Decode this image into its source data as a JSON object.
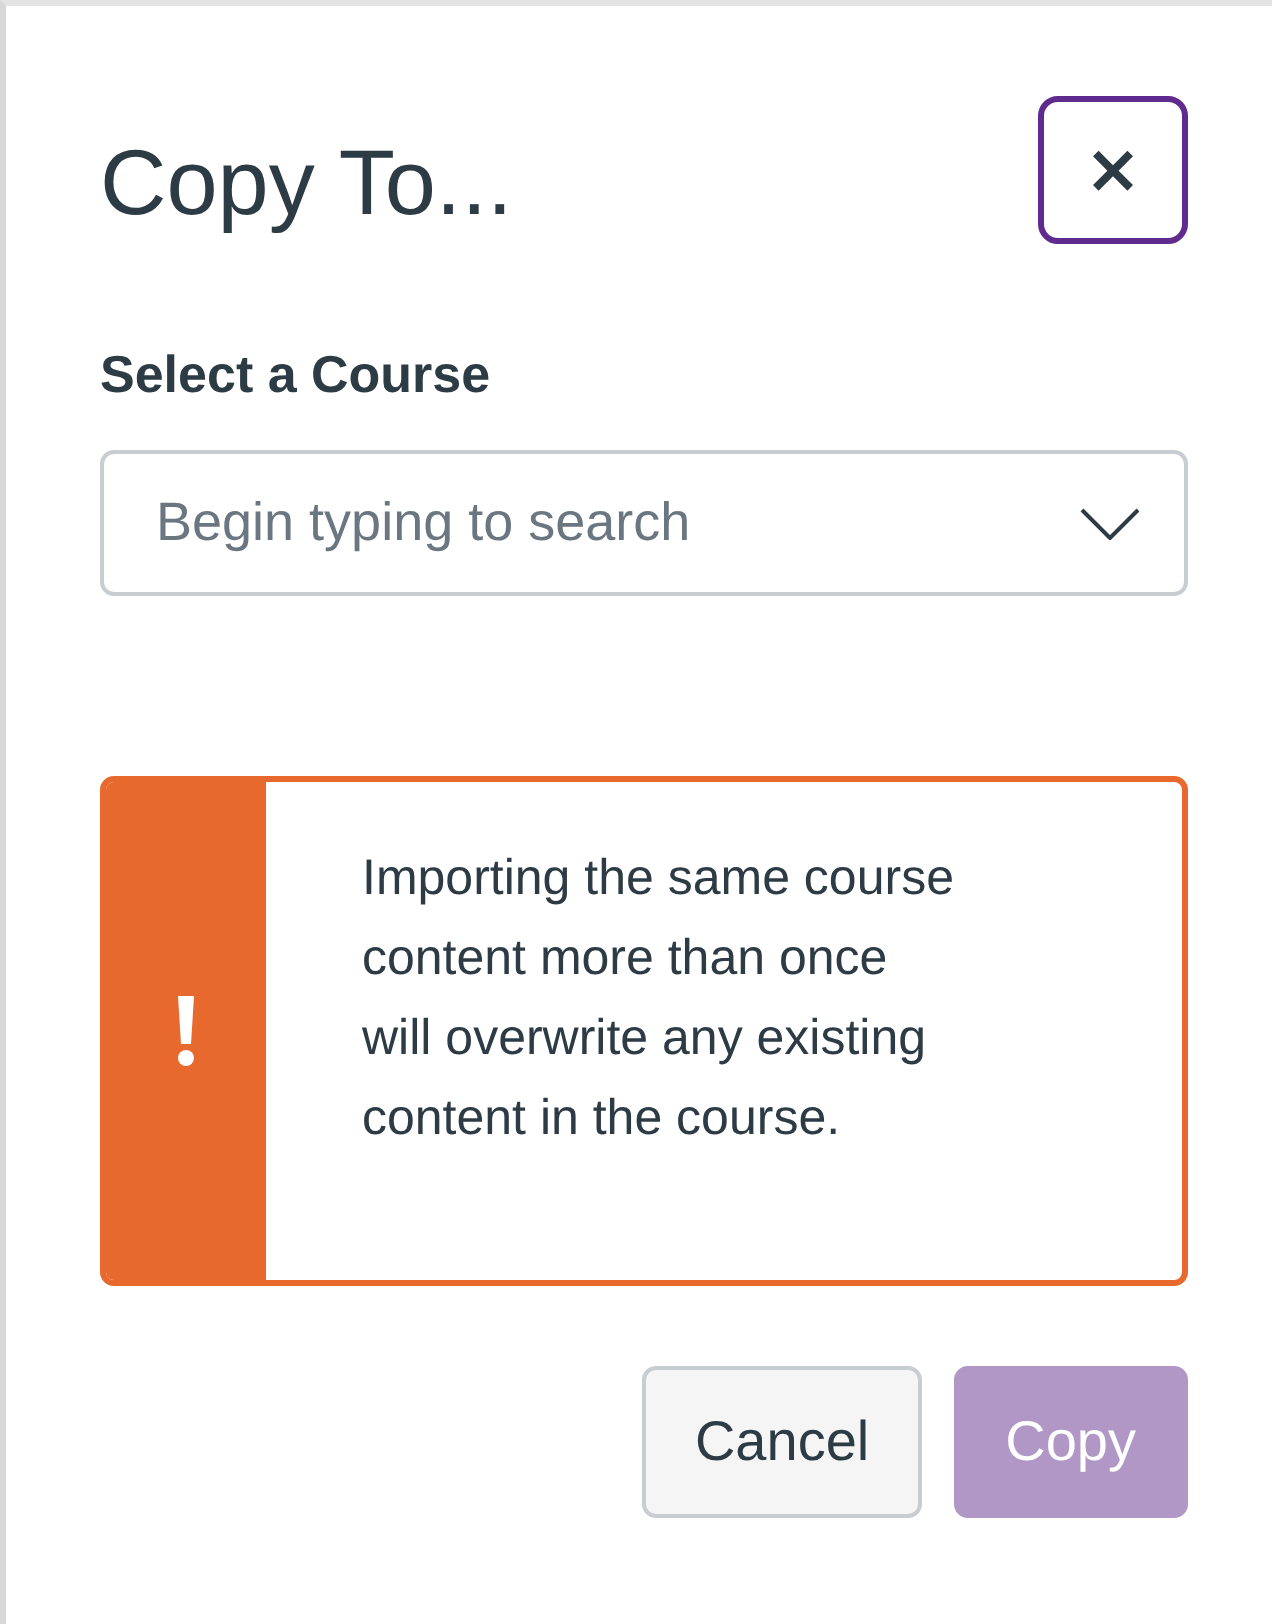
{
  "dialog": {
    "title": "Copy To...",
    "close_button": {
      "label": "×",
      "focused": true
    }
  },
  "course_select": {
    "label": "Select a Course",
    "placeholder": "Begin typing to search"
  },
  "alert": {
    "kind": "warning",
    "message": "Importing the same course content more than once will overwrite any existing content in the course."
  },
  "buttons": [
    {
      "label": "Cancel",
      "kind": "secondary",
      "disabled": false
    },
    {
      "label": "Copy",
      "kind": "primary",
      "disabled": true
    }
  ]
}
